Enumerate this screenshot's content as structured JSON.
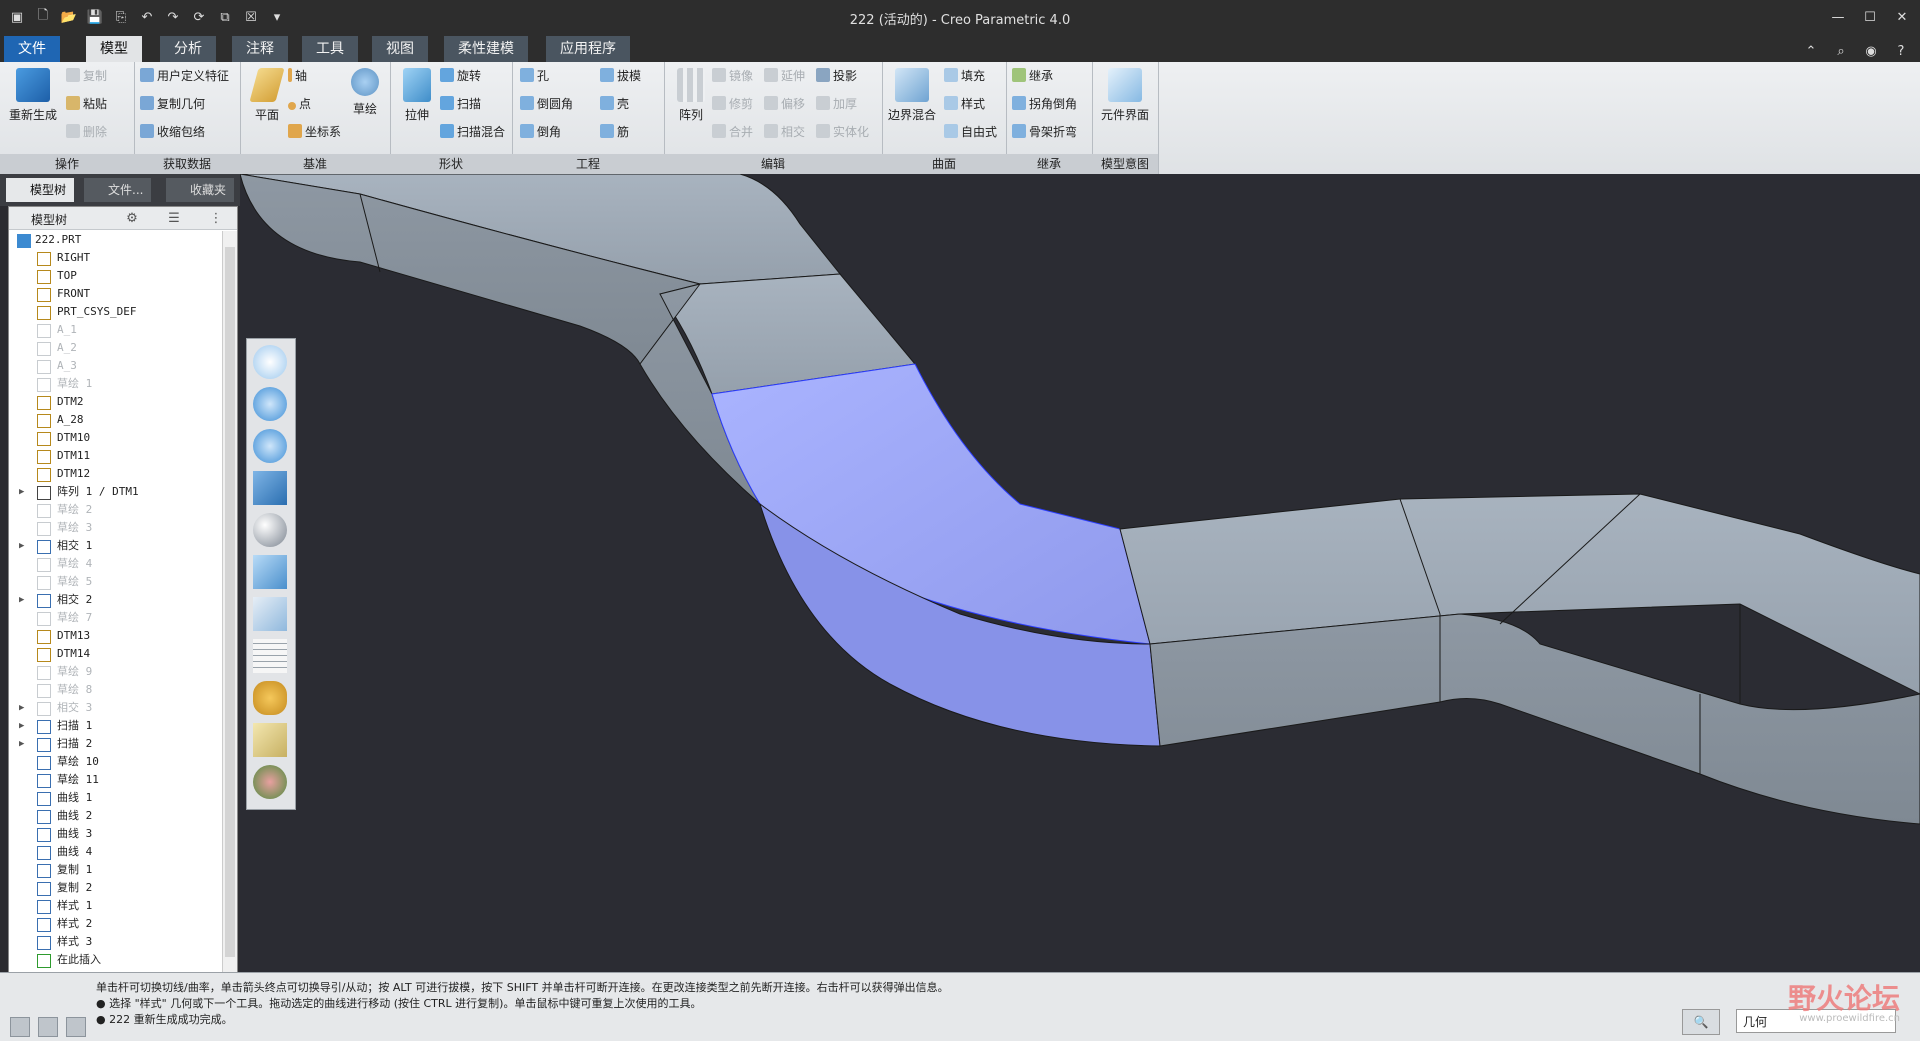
{
  "window": {
    "title": "222 (活动的) - Creo Parametric 4.0"
  },
  "tabs": [
    "文件",
    "模型",
    "分析",
    "注释",
    "工具",
    "视图",
    "柔性建模",
    "应用程序"
  ],
  "active_tab": "模型",
  "ribbon": {
    "operations": {
      "regen": "重新生成",
      "copy": "复制",
      "paste": "粘贴",
      "delete": "删除",
      "label": "操作"
    },
    "get_data": {
      "udf": "用户定义特征",
      "copy_geom": "复制几何",
      "shrinkwrap": "收缩包络",
      "label": "获取数据"
    },
    "datum": {
      "plane": "平面",
      "axis": "轴",
      "point": "点",
      "csys": "坐标系",
      "sketch": "草绘",
      "label": "基准"
    },
    "shapes": {
      "extrude": "拉伸",
      "revolve": "旋转",
      "sweep": "扫描",
      "swept_blend": "扫描混合",
      "label": "形状"
    },
    "engineering": {
      "hole": "孔",
      "round": "倒圆角",
      "chamfer": "倒角",
      "draft": "拔模",
      "shell": "壳",
      "rib": "筋",
      "label": "工程"
    },
    "editing": {
      "pattern": "阵列",
      "mirror": "镜像",
      "extend": "延伸",
      "project": "投影",
      "trim": "修剪",
      "offset": "偏移",
      "thicken": "加厚",
      "merge": "合并",
      "intersect": "相交",
      "solidify": "实体化",
      "label": "编辑"
    },
    "surfaces": {
      "boundary": "边界混合",
      "fill": "填充",
      "style": "样式",
      "freestyle": "自由式",
      "label": "曲面"
    },
    "inherit": {
      "inherit": "继承",
      "corner_chamfer": "拐角倒角",
      "spinal_bend": "骨架折弯",
      "label": "继承"
    },
    "model_intent": {
      "component_interface": "元件界面",
      "label": "模型意图"
    }
  },
  "nav_tabs": [
    "模型树",
    "文件...",
    "收藏夹"
  ],
  "model_tree": {
    "header": "模型树",
    "items": [
      {
        "label": "222.PRT",
        "type": "part",
        "faded": false,
        "expand": false
      },
      {
        "label": "RIGHT",
        "type": "plane",
        "faded": false,
        "expand": false
      },
      {
        "label": "TOP",
        "type": "plane",
        "faded": false,
        "expand": false
      },
      {
        "label": "FRONT",
        "type": "plane",
        "faded": false,
        "expand": false
      },
      {
        "label": "PRT_CSYS_DEF",
        "type": "csys",
        "faded": false,
        "expand": false
      },
      {
        "label": "A_1",
        "type": "axis",
        "faded": true,
        "expand": false
      },
      {
        "label": "A_2",
        "type": "axis",
        "faded": true,
        "expand": false
      },
      {
        "label": "A_3",
        "type": "axis",
        "faded": true,
        "expand": false
      },
      {
        "label": "草绘 1",
        "type": "sketch",
        "faded": true,
        "expand": false
      },
      {
        "label": "DTM2",
        "type": "plane",
        "faded": false,
        "expand": false
      },
      {
        "label": "A_28",
        "type": "axis",
        "faded": false,
        "expand": false
      },
      {
        "label": "DTM10",
        "type": "plane",
        "faded": false,
        "expand": false
      },
      {
        "label": "DTM11",
        "type": "plane",
        "faded": false,
        "expand": false
      },
      {
        "label": "DTM12",
        "type": "plane",
        "faded": false,
        "expand": false
      },
      {
        "label": "阵列 1 / DTM1",
        "type": "pattern",
        "faded": false,
        "expand": true
      },
      {
        "label": "草绘 2",
        "type": "sketch",
        "faded": true,
        "expand": false
      },
      {
        "label": "草绘 3",
        "type": "sketch",
        "faded": true,
        "expand": false
      },
      {
        "label": "相交 1",
        "type": "intersect",
        "faded": false,
        "expand": true
      },
      {
        "label": "草绘 4",
        "type": "sketch",
        "faded": true,
        "expand": false
      },
      {
        "label": "草绘 5",
        "type": "sketch",
        "faded": true,
        "expand": false
      },
      {
        "label": "相交 2",
        "type": "intersect",
        "faded": false,
        "expand": true
      },
      {
        "label": "草绘 7",
        "type": "sketch",
        "faded": true,
        "expand": false
      },
      {
        "label": "DTM13",
        "type": "plane",
        "faded": false,
        "expand": false
      },
      {
        "label": "DTM14",
        "type": "plane",
        "faded": false,
        "expand": false
      },
      {
        "label": "草绘 9",
        "type": "sketch",
        "faded": true,
        "expand": false
      },
      {
        "label": "草绘 8",
        "type": "sketch",
        "faded": true,
        "expand": false
      },
      {
        "label": "相交 3",
        "type": "intersect",
        "faded": true,
        "expand": true
      },
      {
        "label": "扫描 1",
        "type": "sweep",
        "faded": false,
        "expand": true
      },
      {
        "label": "扫描 2",
        "type": "sweep",
        "faded": false,
        "expand": true
      },
      {
        "label": "草绘 10",
        "type": "sketch",
        "faded": false,
        "expand": false
      },
      {
        "label": "草绘 11",
        "type": "sketch",
        "faded": false,
        "expand": false
      },
      {
        "label": "曲线 1",
        "type": "curve",
        "faded": false,
        "expand": false
      },
      {
        "label": "曲线 2",
        "type": "curve",
        "faded": false,
        "expand": false
      },
      {
        "label": "曲线 3",
        "type": "curve",
        "faded": false,
        "expand": false
      },
      {
        "label": "曲线 4",
        "type": "curve",
        "faded": false,
        "expand": false
      },
      {
        "label": "复制 1",
        "type": "copy",
        "faded": false,
        "expand": false
      },
      {
        "label": "复制 2",
        "type": "copy",
        "faded": false,
        "expand": false
      },
      {
        "label": "样式 1",
        "type": "style",
        "faded": false,
        "expand": false
      },
      {
        "label": "样式 2",
        "type": "style",
        "faded": false,
        "expand": false
      },
      {
        "label": "样式 3",
        "type": "style",
        "faded": false,
        "expand": false
      },
      {
        "label": "在此插入",
        "type": "insert",
        "faded": false,
        "expand": false
      }
    ]
  },
  "status": {
    "line1": "单击杆可切换切线/曲率，单击箭头终点可切换导引/从动；按 ALT 可进行拔模，按下 SHIFT 并单击杆可断开连接。在更改连接类型之前先断开连接。右击杆可以获得弹出信息。",
    "line2": "● 选择 \"样式\" 几何或下一个工具。拖动选定的曲线进行移动 (按住 CTRL 进行复制)。单击鼠标中键可重复上次使用的工具。",
    "line3": "● 222 重新生成成功完成。",
    "filter": "几何"
  },
  "watermark": {
    "text": "野火论坛",
    "url": "www.proewildfire.cn"
  },
  "colors": {
    "highlight": "#9da7f2",
    "model": "#9ba6b2",
    "background": "#2b2c33"
  }
}
